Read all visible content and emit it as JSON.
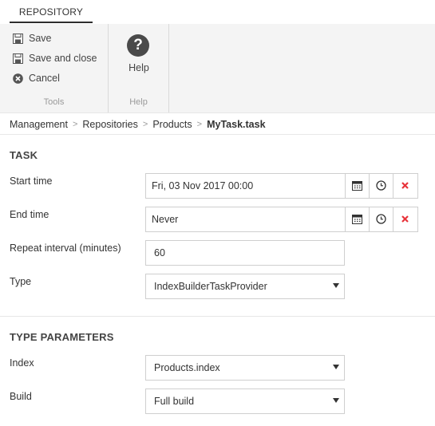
{
  "tabs": {
    "repository": "REPOSITORY"
  },
  "ribbon": {
    "save": "Save",
    "save_and_close": "Save and close",
    "cancel": "Cancel",
    "tools_group": "Tools",
    "help": "Help",
    "help_group": "Help"
  },
  "breadcrumb": [
    "Management",
    "Repositories",
    "Products",
    "MyTask.task"
  ],
  "task": {
    "title": "TASK",
    "start_time_label": "Start time",
    "start_time_value": "Fri, 03 Nov 2017 00:00",
    "end_time_label": "End time",
    "end_time_value": "Never",
    "repeat_label": "Repeat interval (minutes)",
    "repeat_value": "60",
    "type_label": "Type",
    "type_value": "IndexBuilderTaskProvider"
  },
  "type_parameters": {
    "title": "TYPE PARAMETERS",
    "index_label": "Index",
    "index_value": "Products.index",
    "build_label": "Build",
    "build_value": "Full build"
  },
  "colors": {
    "clear_red": "#e8333a",
    "help_circle": "#4a4a4a"
  }
}
